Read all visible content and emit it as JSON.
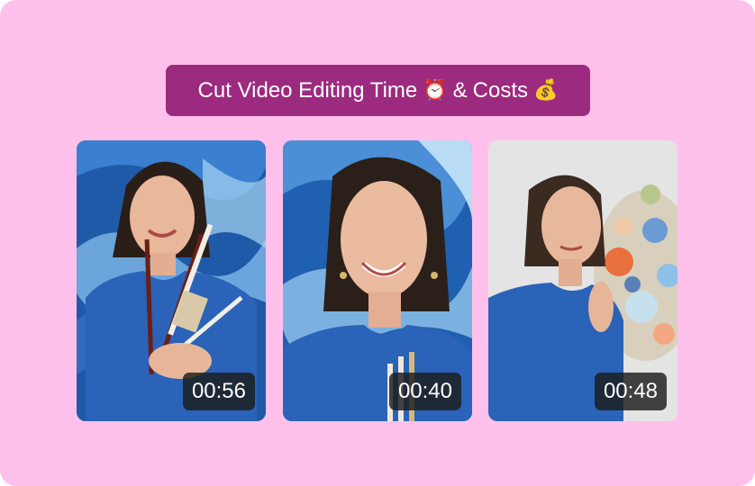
{
  "headline": {
    "text": "Cut Video Editing Time",
    "emoji_clock": "⏰",
    "connector": "&",
    "text2": "Costs",
    "emoji_money": "💰"
  },
  "videos": [
    {
      "duration": "00:56",
      "icon": "video-thumbnail",
      "scene": "woman holding paint brushes in front of blue painting"
    },
    {
      "duration": "00:40",
      "icon": "video-thumbnail",
      "scene": "smiling woman close-up with brushes, blue background"
    },
    {
      "duration": "00:48",
      "icon": "video-thumbnail",
      "scene": "woman holding colorful paint palette, grey background"
    }
  ],
  "colors": {
    "background": "#ffc0ec",
    "headline_bg": "#9c2a7e",
    "dress_blue": "#2a63b8",
    "badge_bg": "#1c1c1c"
  }
}
